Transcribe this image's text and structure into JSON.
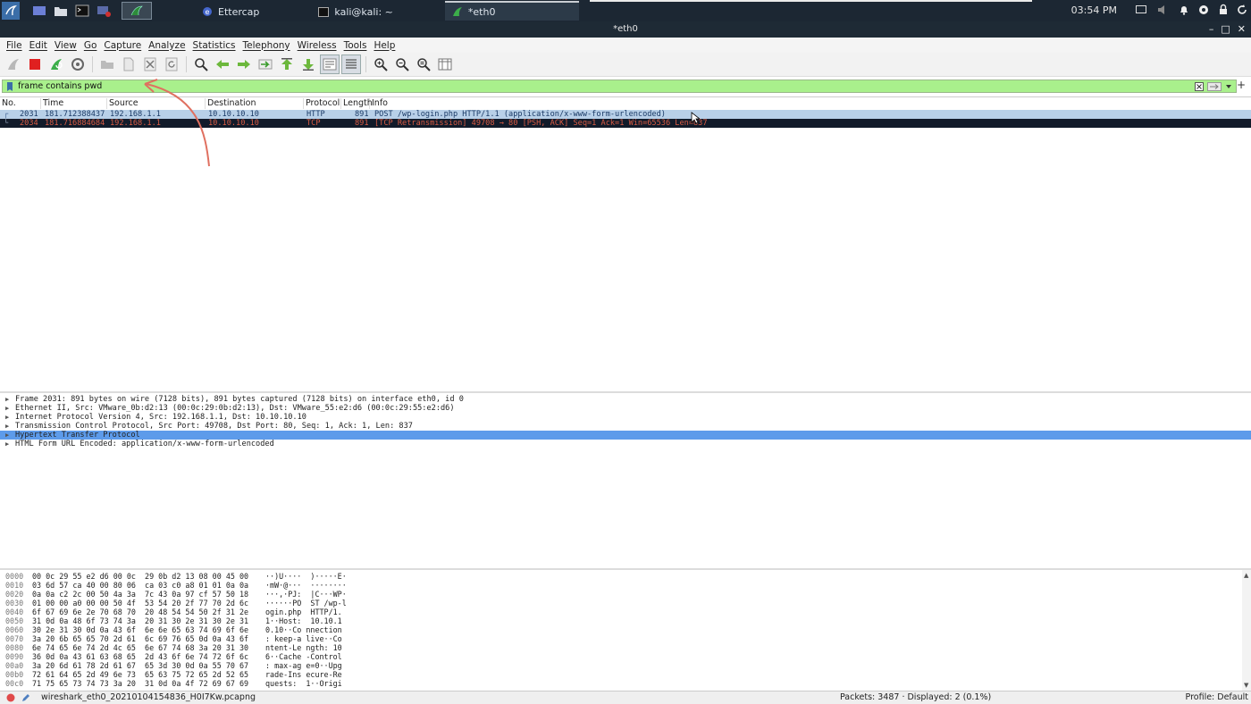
{
  "taskbar": {
    "tasks": [
      {
        "label": "Ettercap"
      },
      {
        "label": "kali@kali: ~"
      },
      {
        "label": "*eth0"
      }
    ],
    "clock": "03:54 PM"
  },
  "window": {
    "title": "*eth0"
  },
  "menu": [
    "File",
    "Edit",
    "View",
    "Go",
    "Capture",
    "Analyze",
    "Statistics",
    "Telephony",
    "Wireless",
    "Tools",
    "Help"
  ],
  "filter": {
    "value": "frame contains pwd"
  },
  "packet_list": {
    "headers": [
      "No.",
      "Time",
      "Source",
      "Destination",
      "Protocol",
      "Length",
      "Info"
    ],
    "rows": [
      {
        "no": "2031",
        "time": "181.712388437",
        "src": "192.168.1.1",
        "dst": "10.10.10.10",
        "proto": "HTTP",
        "len": "891",
        "info": "POST /wp-login.php HTTP/1.1  (application/x-www-form-urlencoded)"
      },
      {
        "no": "2034",
        "time": "181.716884684",
        "src": "192.168.1.1",
        "dst": "10.10.10.10",
        "proto": "TCP",
        "len": "891",
        "info": "[TCP Retransmission] 49708 → 80 [PSH, ACK] Seq=1 Ack=1 Win=65536 Len=837"
      }
    ]
  },
  "details": [
    "Frame 2031: 891 bytes on wire (7128 bits), 891 bytes captured (7128 bits) on interface eth0, id 0",
    "Ethernet II, Src: VMware_0b:d2:13 (00:0c:29:0b:d2:13), Dst: VMware_55:e2:d6 (00:0c:29:55:e2:d6)",
    "Internet Protocol Version 4, Src: 192.168.1.1, Dst: 10.10.10.10",
    "Transmission Control Protocol, Src Port: 49708, Dst Port: 80, Seq: 1, Ack: 1, Len: 837",
    "Hypertext Transfer Protocol",
    "HTML Form URL Encoded: application/x-www-form-urlencoded"
  ],
  "details_selected_index": 4,
  "bytes": [
    {
      "off": "0000",
      "hex": "00 0c 29 55 e2 d6 00 0c  29 0b d2 13 08 00 45 00",
      "asc": "··)U····  )·····E·"
    },
    {
      "off": "0010",
      "hex": "03 6d 57 ca 40 00 80 06  ca 03 c0 a8 01 01 0a 0a",
      "asc": "·mW·@···  ········"
    },
    {
      "off": "0020",
      "hex": "0a 0a c2 2c 00 50 4a 3a  7c 43 0a 97 cf 57 50 18",
      "asc": "···,·PJ:  |C···WP·"
    },
    {
      "off": "0030",
      "hex": "01 00 00 a0 00 00 50 4f  53 54 20 2f 77 70 2d 6c",
      "asc": "······PO  ST /wp-l"
    },
    {
      "off": "0040",
      "hex": "6f 67 69 6e 2e 70 68 70  20 48 54 54 50 2f 31 2e",
      "asc": "ogin.php  HTTP/1."
    },
    {
      "off": "0050",
      "hex": "31 0d 0a 48 6f 73 74 3a  20 31 30 2e 31 30 2e 31",
      "asc": "1··Host:  10.10.1"
    },
    {
      "off": "0060",
      "hex": "30 2e 31 30 0d 0a 43 6f  6e 6e 65 63 74 69 6f 6e",
      "asc": "0.10··Co nnection"
    },
    {
      "off": "0070",
      "hex": "3a 20 6b 65 65 70 2d 61  6c 69 76 65 0d 0a 43 6f",
      "asc": ": keep-a live··Co"
    },
    {
      "off": "0080",
      "hex": "6e 74 65 6e 74 2d 4c 65  6e 67 74 68 3a 20 31 30",
      "asc": "ntent-Le ngth: 10"
    },
    {
      "off": "0090",
      "hex": "36 0d 0a 43 61 63 68 65  2d 43 6f 6e 74 72 6f 6c",
      "asc": "6··Cache -Control"
    },
    {
      "off": "00a0",
      "hex": "3a 20 6d 61 78 2d 61 67  65 3d 30 0d 0a 55 70 67",
      "asc": ": max-ag e=0··Upg"
    },
    {
      "off": "00b0",
      "hex": "72 61 64 65 2d 49 6e 73  65 63 75 72 65 2d 52 65",
      "asc": "rade-Ins ecure-Re"
    },
    {
      "off": "00c0",
      "hex": "71 75 65 73 74 73 3a 20  31 0d 0a 4f 72 69 67 69",
      "asc": "quests:  1··Origi"
    }
  ],
  "status": {
    "file": "wireshark_eth0_20210104154836_H0I7Kw.pcapng",
    "packets": "Packets: 3487 · Displayed: 2 (0.1%)",
    "profile": "Profile: Default"
  },
  "colors": {
    "filter_ok": "#a9f08c",
    "selected_row": "#b8d0e8",
    "retransmission_row": "#121b2a",
    "retransmission_text": "#d95c44",
    "detail_selected": "#5d9bea",
    "annotation_arrow": "#e07060"
  }
}
